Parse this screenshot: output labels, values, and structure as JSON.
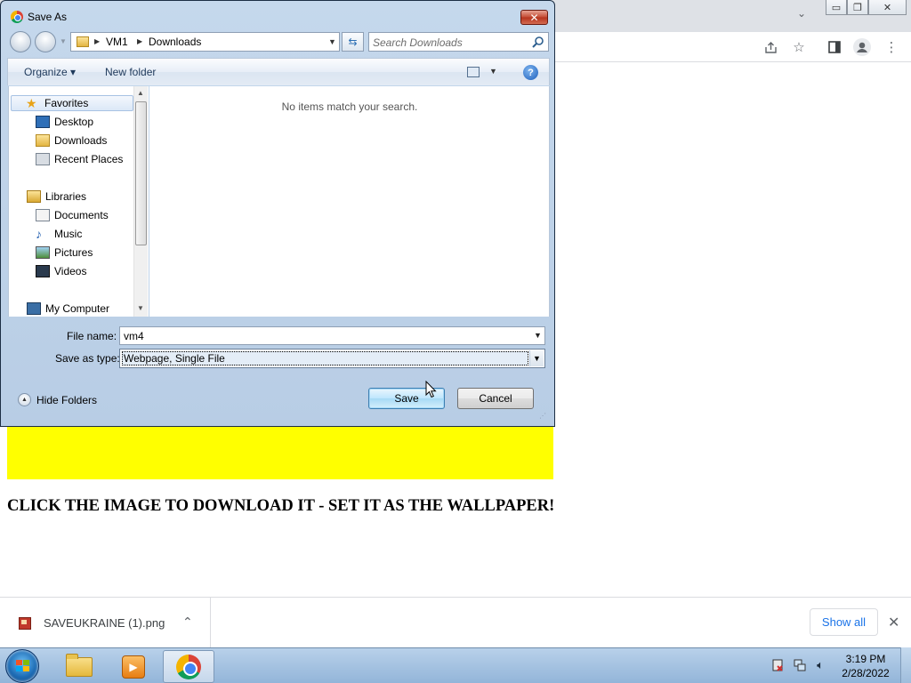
{
  "browser": {
    "window_controls": {
      "minimize": "▭",
      "restore": "❐",
      "close": "✕"
    },
    "toolbar_icons": [
      "share-icon",
      "star-icon",
      "side-panel-icon",
      "profile-icon",
      "more-icon"
    ]
  },
  "page": {
    "banner_color": "#ffff00",
    "heading": "CLICK THE IMAGE TO DOWNLOAD IT - SET IT AS THE WALLPAPER!"
  },
  "dialog": {
    "title": "Save As",
    "close_label": "✕",
    "breadcrumb": [
      "VM1",
      "Downloads"
    ],
    "search_placeholder": "Search Downloads",
    "toolbar": {
      "organize": "Organize ▾",
      "new_folder": "New folder"
    },
    "nav_tree": {
      "favorites": {
        "label": "Favorites",
        "items": [
          "Desktop",
          "Downloads",
          "Recent Places"
        ]
      },
      "libraries": {
        "label": "Libraries",
        "items": [
          "Documents",
          "Music",
          "Pictures",
          "Videos"
        ]
      },
      "computer": "My Computer"
    },
    "empty_message": "No items match your search.",
    "file_name_label": "File name:",
    "file_name_value": "vm4",
    "save_as_type_label": "Save as type:",
    "save_as_type_value": "Webpage, Single File",
    "hide_folders": "Hide Folders",
    "save_button": "Save",
    "cancel_button": "Cancel"
  },
  "downloads": {
    "filename": "SAVEUKRAINE (1).png",
    "show_all": "Show all"
  },
  "taskbar": {
    "time": "3:19 PM",
    "date": "2/28/2022"
  }
}
